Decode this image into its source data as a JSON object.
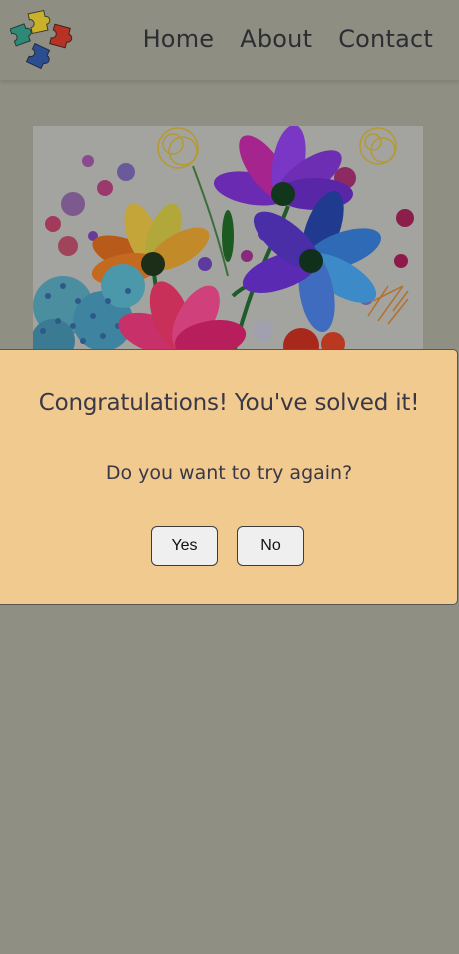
{
  "nav": {
    "logo_icon": "puzzle-pieces-logo-icon",
    "items": [
      {
        "label": "Home"
      },
      {
        "label": "About"
      },
      {
        "label": "Contact"
      }
    ]
  },
  "main": {
    "image": "watercolor-flowers-painting"
  },
  "modal": {
    "title": "Congratulations! You've solved it!",
    "message": "Do you want to try again?",
    "yes_label": "Yes",
    "no_label": "No",
    "background_color": "#f1ca8f"
  },
  "colors": {
    "overlay": "#8f8f84",
    "text": "#3a3747"
  }
}
